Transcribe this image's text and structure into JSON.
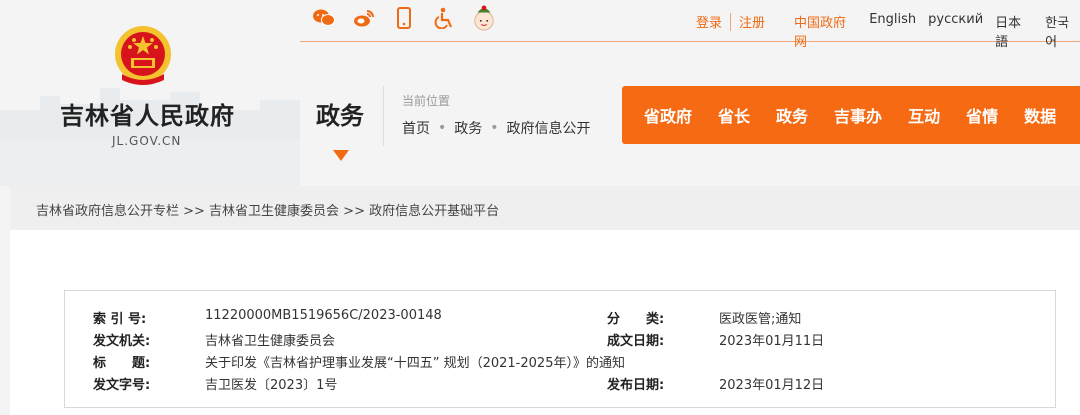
{
  "header": {
    "icons": [
      "wechat-icon",
      "weibo-icon",
      "mobile-icon",
      "accessibility-icon",
      "mascot-icon"
    ],
    "login": "登录",
    "register": "注册",
    "languages": [
      "中国政府网",
      "English",
      "русский",
      "日本語",
      "한국어"
    ],
    "site_name": "吉林省人民政府",
    "site_domain": "JL.GOV.CN",
    "section_title": "政务",
    "location_label": "当前位置",
    "location_path": [
      "首页",
      "政务",
      "政府信息公开"
    ],
    "nav": [
      "省政府",
      "省长",
      "政务",
      "吉事办",
      "互动",
      "省情",
      "数据"
    ]
  },
  "breadcrumb": "吉林省政府信息公开专栏 >> 吉林省卫生健康委员会 >> 政府信息公开基础平台",
  "meta": {
    "index_label": "索 引 号:",
    "index_value": "11220000MB1519656C/2023-00148",
    "category_label": "分　　类:",
    "category_value": "医政医管;通知",
    "issuer_label": "发文机关:",
    "issuer_value": "吉林省卫生健康委员会",
    "date_label": "成文日期:",
    "date_value": "2023年01月11日",
    "title_label": "标　　题:",
    "title_value": "关于印发《吉林省护理事业发展“十四五” 规划（2021-2025年）》的通知",
    "docno_label": "发文字号:",
    "docno_value": "吉卫医发〔2023〕1号",
    "pubdate_label": "发布日期:",
    "pubdate_value": "2023年01月12日"
  },
  "colors": {
    "accent": "#f56a12",
    "emblem_red": "#d7141b",
    "emblem_gold": "#f4c12f"
  }
}
